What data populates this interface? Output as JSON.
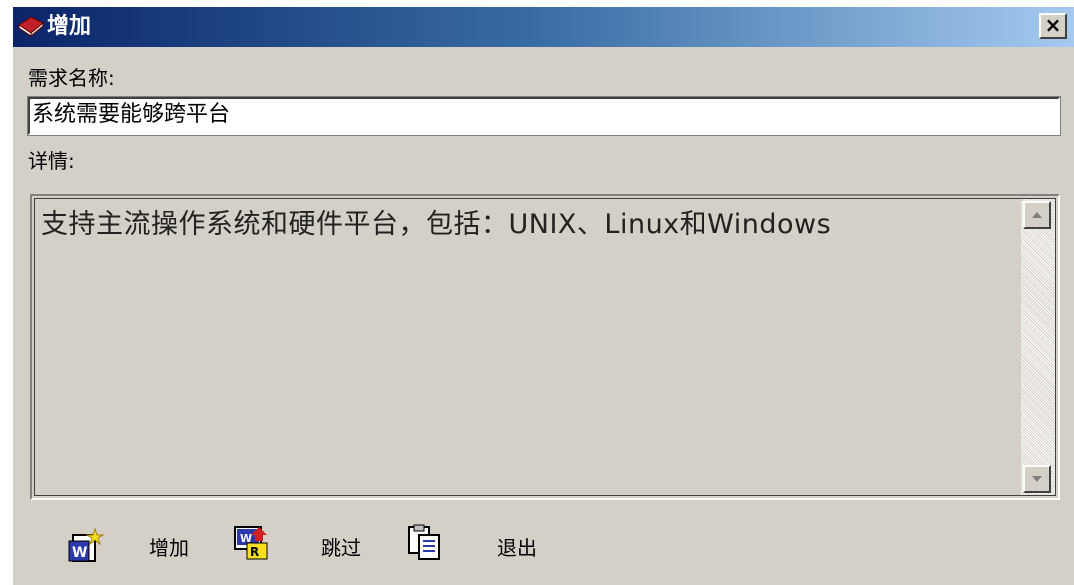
{
  "window": {
    "title": "增加",
    "close_label": "×"
  },
  "form": {
    "name_label": "需求名称:",
    "name_value": "系统需要能够跨平台",
    "details_label": "详情:",
    "details_value": "支持主流操作系统和硬件平台，包括：UNIX、Linux和Windows"
  },
  "toolbar": {
    "add_label": "增加",
    "skip_label": "跳过",
    "exit_label": "退出"
  },
  "icons": {
    "title": "red-book-icon",
    "add": "new-document-icon",
    "skip": "skip-document-icon",
    "exit": "clipboard-icon"
  }
}
